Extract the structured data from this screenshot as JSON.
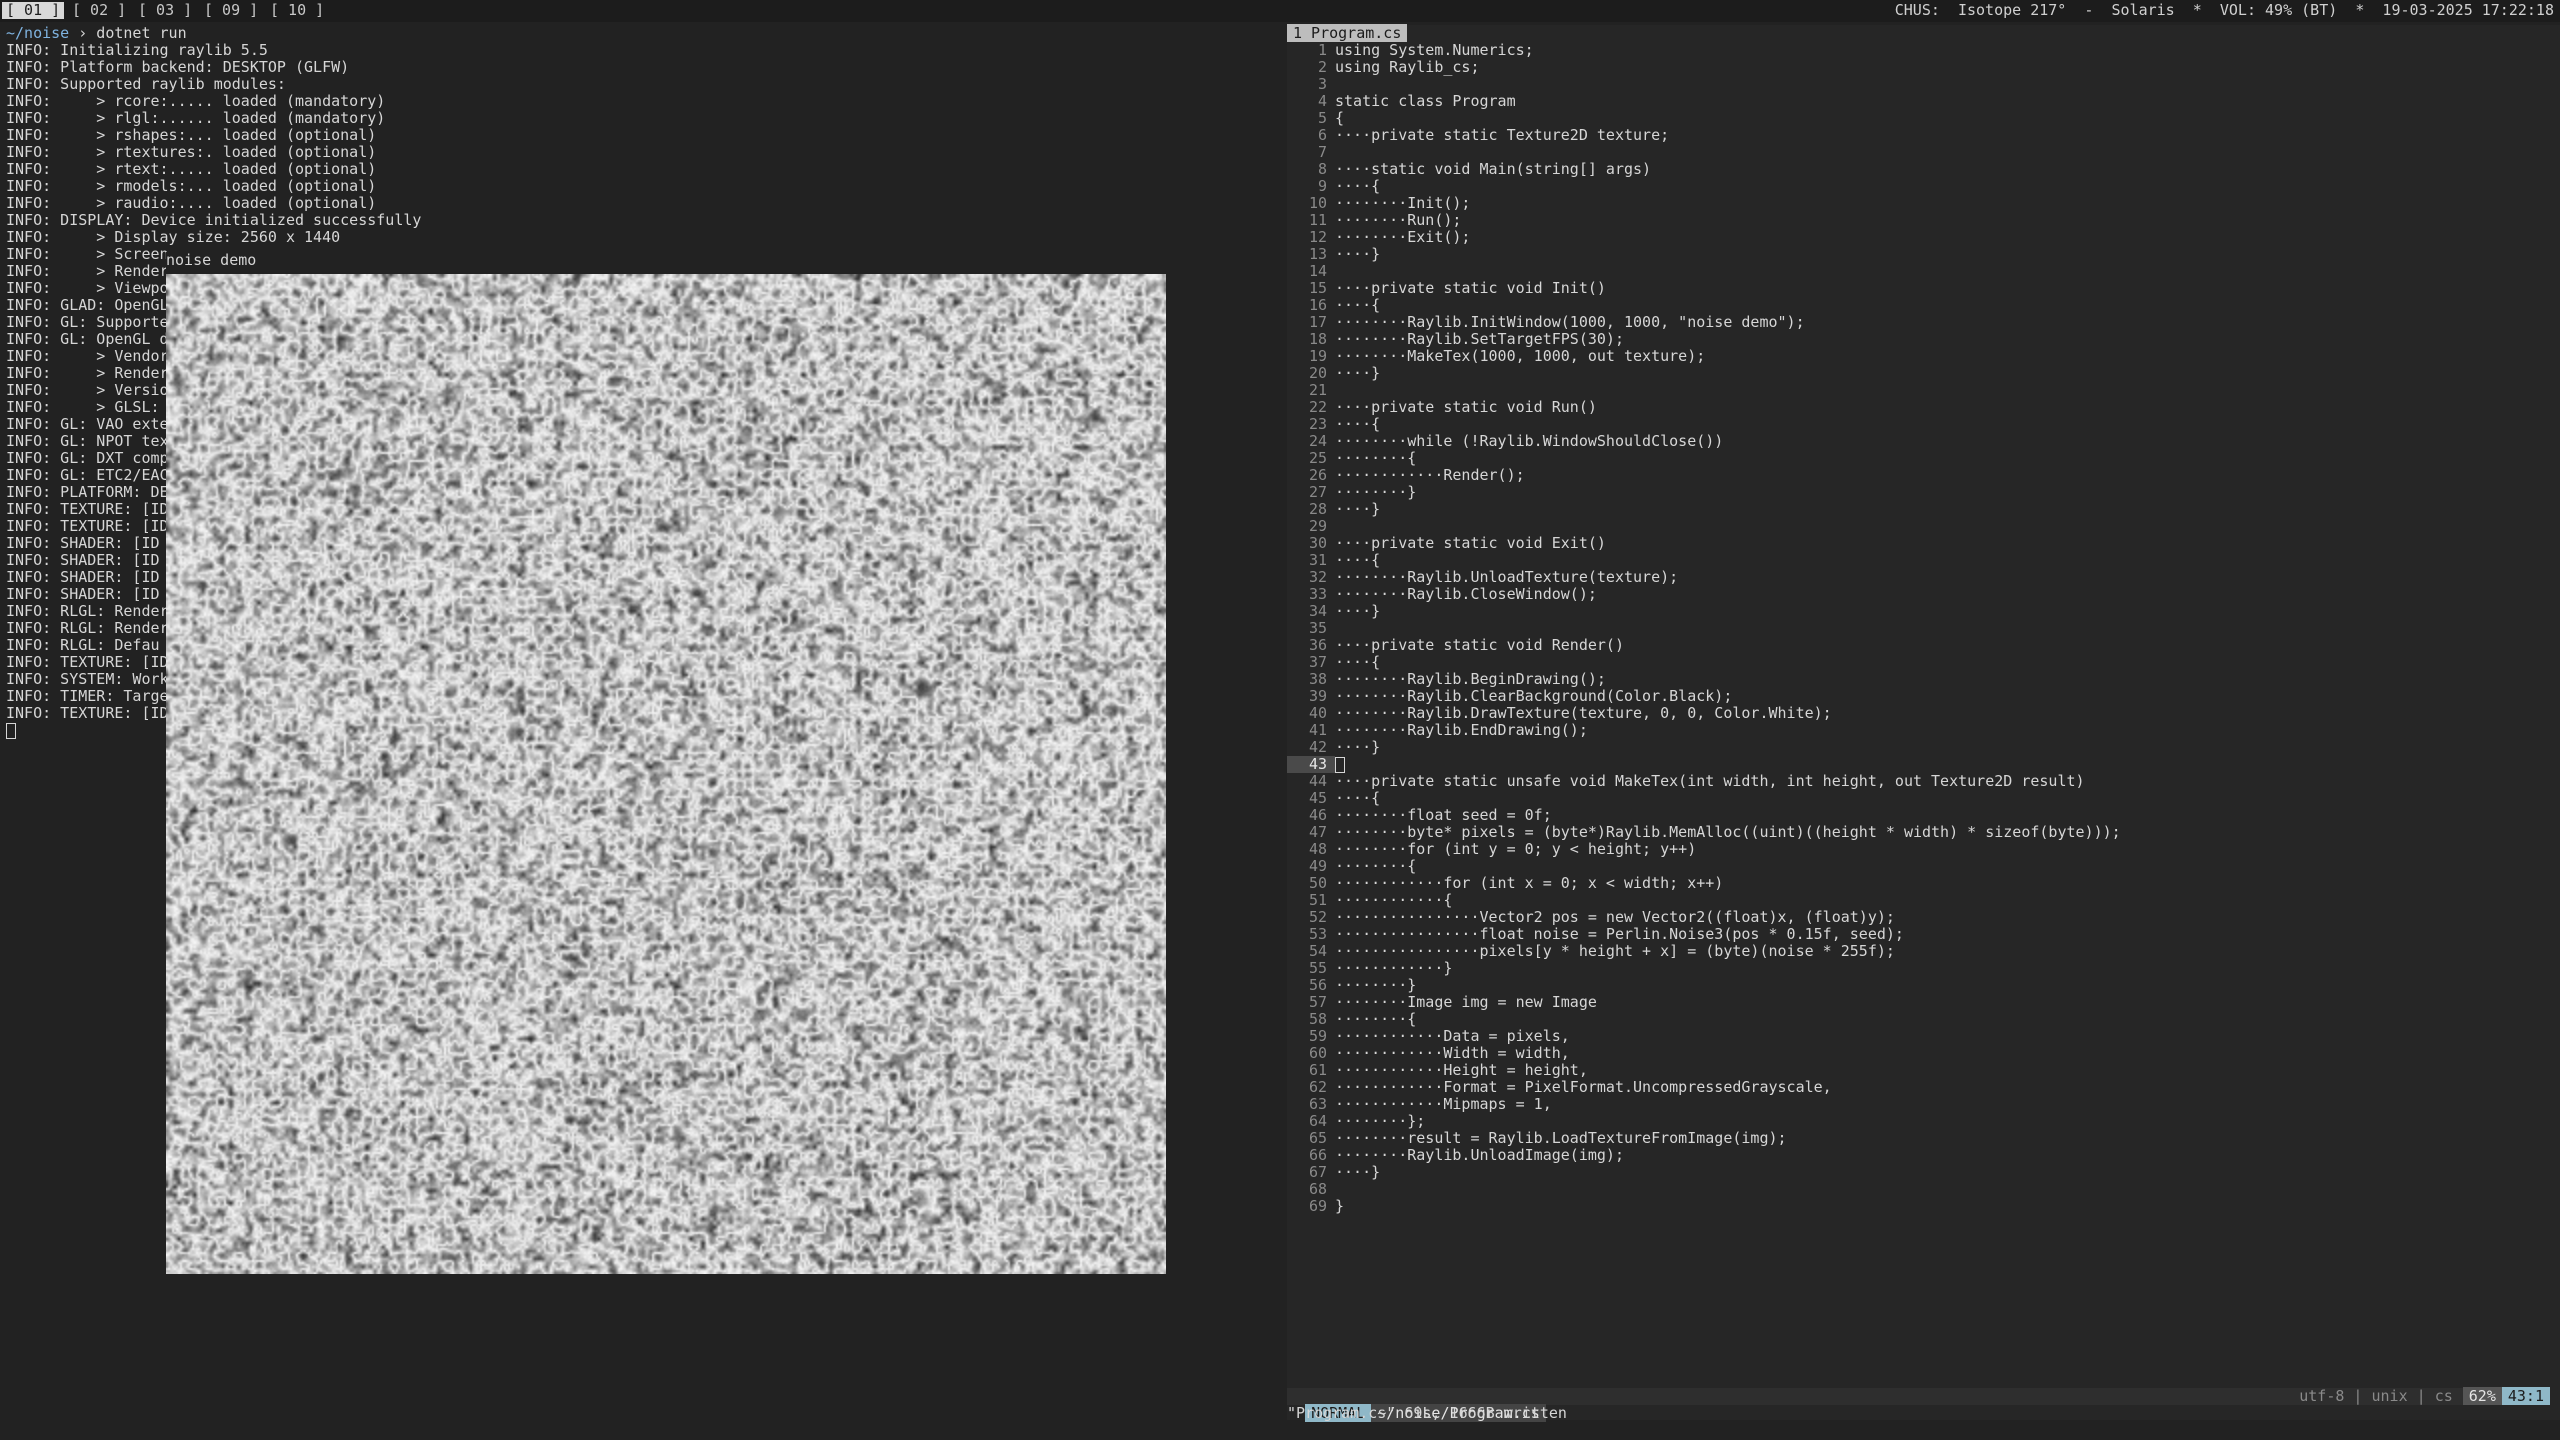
{
  "topbar": {
    "workspaces": [
      "[ 01 ]",
      "[ 02 ]",
      "[ 03 ]",
      "[ 09 ]",
      "[ 10 ]"
    ],
    "status": "CHUS:  Isotope 217°  -  Solaris  *  VOL: 49% (BT)  *  19-03-2025 17:22:18"
  },
  "terminal": {
    "prompt_dir": "~/noise",
    "prompt_cmd": " › dotnet run",
    "lines": [
      "INFO: Initializing raylib 5.5",
      "INFO: Platform backend: DESKTOP (GLFW)",
      "INFO: Supported raylib modules:",
      "INFO:     > rcore:..... loaded (mandatory)",
      "INFO:     > rlgl:...... loaded (mandatory)",
      "INFO:     > rshapes:... loaded (optional)",
      "INFO:     > rtextures:. loaded (optional)",
      "INFO:     > rtext:..... loaded (optional)",
      "INFO:     > rmodels:... loaded (optional)",
      "INFO:     > raudio:.... loaded (optional)",
      "INFO: DISPLAY: Device initialized successfully",
      "INFO:     > Display size: 2560 x 1440",
      "INFO:     > Screen",
      "INFO:     > Render",
      "INFO:     > Viewpo",
      "INFO: GLAD: OpenGL",
      "INFO: GL: Supporte",
      "INFO: GL: OpenGL d",
      "INFO:     > Vendor",
      "INFO:     > Render",
      "INFO:     > Versio",
      "INFO:     > GLSL:",
      "INFO: GL: VAO exte",
      "INFO: GL: NPOT tex",
      "INFO: GL: DXT comp",
      "INFO: GL: ETC2/EAC",
      "INFO: PLATFORM: DE",
      "INFO: TEXTURE: [ID",
      "INFO: TEXTURE: [ID",
      "INFO: SHADER: [ID",
      "INFO: SHADER: [ID",
      "INFO: SHADER: [ID",
      "INFO: SHADER: [ID",
      "INFO: RLGL: Render",
      "INFO: RLGL: Render",
      "INFO: RLGL: Defau",
      "INFO: TEXTURE: [ID",
      "INFO: SYSTEM: Work",
      "INFO: TIMER: Targe",
      "INFO: TEXTURE: [ID"
    ]
  },
  "raylib_window": {
    "title": "noise demo"
  },
  "editor": {
    "tab": "1 Program.cs",
    "current_line": "43",
    "lines": [
      "using System.Numerics;",
      "using Raylib_cs;",
      "",
      "static class Program",
      "{",
      "····private static Texture2D texture;",
      "",
      "····static void Main(string[] args)",
      "····{",
      "········Init();",
      "········Run();",
      "········Exit();",
      "····}",
      "",
      "····private static void Init()",
      "····{",
      "········Raylib.InitWindow(1000, 1000, \"noise demo\");",
      "········Raylib.SetTargetFPS(30);",
      "········MakeTex(1000, 1000, out texture);",
      "····}",
      "",
      "····private static void Run()",
      "····{",
      "········while (!Raylib.WindowShouldClose())",
      "········{",
      "············Render();",
      "········}",
      "····}",
      "",
      "····private static void Exit()",
      "····{",
      "········Raylib.UnloadTexture(texture);",
      "········Raylib.CloseWindow();",
      "····}",
      "",
      "····private static void Render()",
      "····{",
      "········Raylib.BeginDrawing();",
      "········Raylib.ClearBackground(Color.Black);",
      "········Raylib.DrawTexture(texture, 0, 0, Color.White);",
      "········Raylib.EndDrawing();",
      "····}",
      "",
      "····private static unsafe void MakeTex(int width, int height, out Texture2D result)",
      "····{",
      "········float seed = 0f;",
      "········byte* pixels = (byte*)Raylib.MemAlloc((uint)((height * width) * sizeof(byte)));",
      "········for (int y = 0; y < height; y++)",
      "········{",
      "············for (int x = 0; x < width; x++)",
      "············{",
      "················Vector2 pos = new Vector2((float)x, (float)y);",
      "················float noise = Perlin.Noise3(pos * 0.15f, seed);",
      "················pixels[y * height + x] = (byte)(noise * 255f);",
      "············}",
      "········}",
      "········Image img = new Image",
      "········{",
      "············Data = pixels,",
      "············Width = width,",
      "············Height = height,",
      "············Format = PixelFormat.UncompressedGrayscale,",
      "············Mipmaps = 1,",
      "········};",
      "········result = Raylib.LoadTextureFromImage(img);",
      "········Raylib.UnloadImage(img);",
      "····}",
      "",
      "}"
    ]
  },
  "vim_status": {
    "mode": "NORMAL",
    "path": "~/noise/Program.cs",
    "encoding": "utf-8 | unix | cs",
    "percent": "62%",
    "position": "43:1"
  },
  "vim_message": "\"Program.cs\" 69L, 1666B written"
}
